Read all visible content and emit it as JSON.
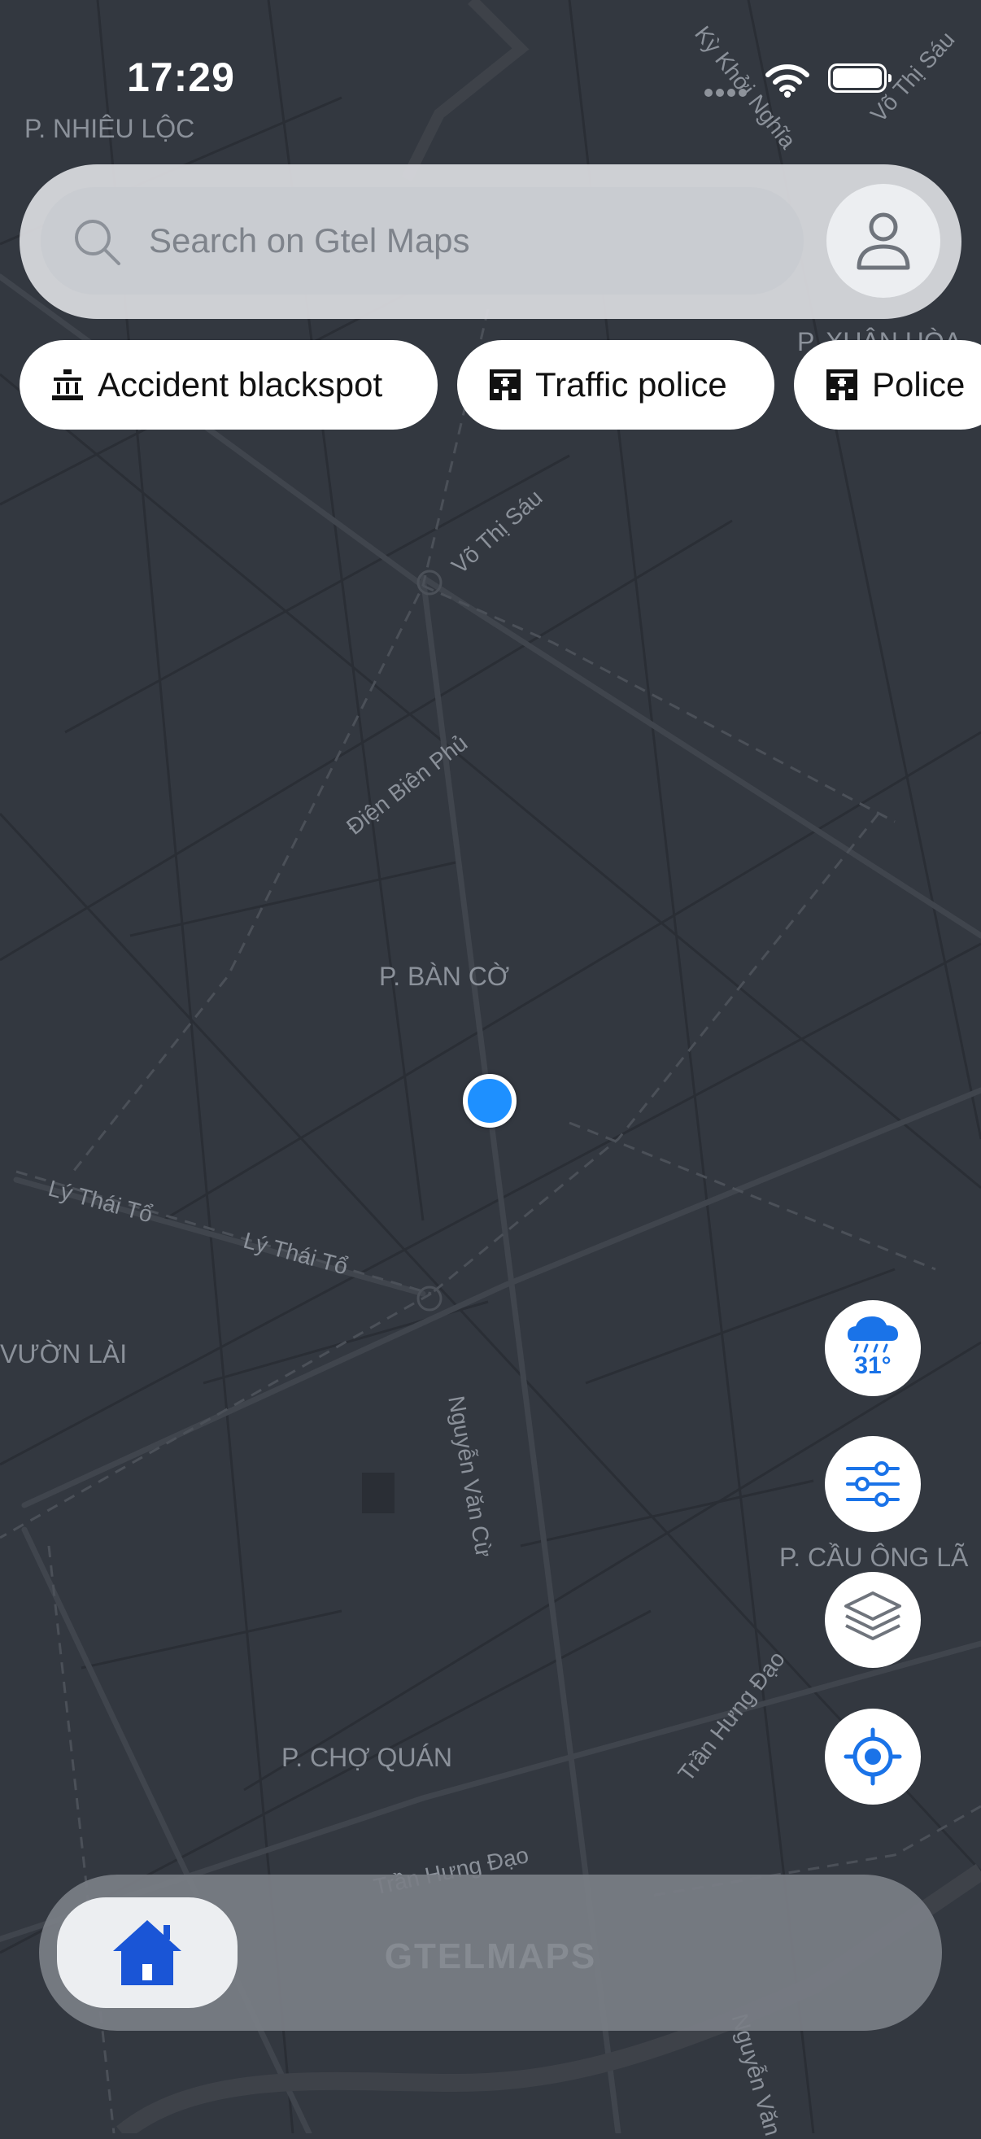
{
  "status_bar": {
    "time": "17:29"
  },
  "search": {
    "placeholder": "Search on Gtel Maps"
  },
  "chips": [
    {
      "label": "Accident blackspot",
      "icon": "accident-blackspot-icon"
    },
    {
      "label": "Traffic police",
      "icon": "traffic-police-icon"
    },
    {
      "label": "Police",
      "icon": "police-station-icon"
    }
  ],
  "map": {
    "area_labels": [
      "P. NHIÊU LỘC",
      "P. XUÂN HÒA",
      "P. BÀN CỜ",
      "VƯỜN LÀI",
      "P. CẦU ÔNG LÃ",
      "P. CHỢ QUÁN"
    ],
    "street_labels": [
      "Kỳ Khởi Nghĩa",
      "Võ Thị Sáu",
      "Võ Thị Sáu",
      "Điện Biên Phủ",
      "Lý Thái Tổ",
      "Lý Thái Tổ",
      "Nguyễn Văn Cừ",
      "Trần Hưng Đạo",
      "Trần Hưng Đạo",
      "Nguyễn Văn"
    ]
  },
  "weather": {
    "temperature": "31°",
    "icon": "rain-cloud-icon"
  },
  "controls": [
    "filter-icon",
    "layers-icon",
    "my-location-icon"
  ],
  "bottom_bar": {
    "watermark": "GTELMAPS",
    "home_icon": "home-icon"
  },
  "colors": {
    "accent": "#1a73e8",
    "map_background": "#333840",
    "user_dot": "#1e90ff"
  }
}
